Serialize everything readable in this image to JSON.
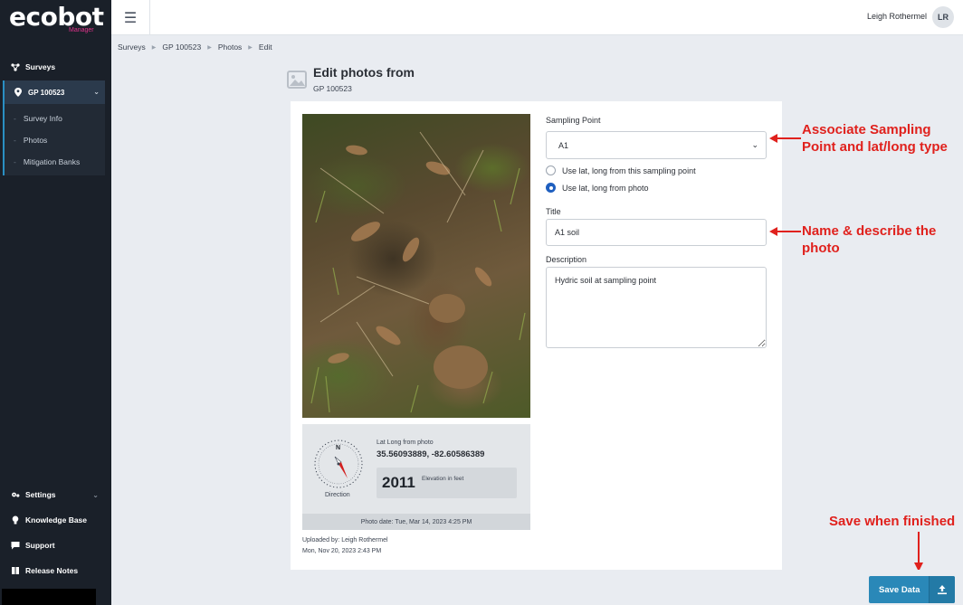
{
  "app": {
    "logo_text": "ecobot",
    "logo_sub": "Manager"
  },
  "sidebar": {
    "surveys_label": "Surveys",
    "survey_label": "GP 100523",
    "sub_items": [
      "Survey Info",
      "Photos",
      "Mitigation Banks"
    ],
    "settings_label": "Settings",
    "knowledge_label": "Knowledge Base",
    "support_label": "Support",
    "release_label": "Release Notes"
  },
  "topbar": {
    "user_name": "Leigh Rothermel",
    "avatar_initials": "LR"
  },
  "breadcrumb": [
    "Surveys",
    "GP 100523",
    "Photos",
    "Edit"
  ],
  "header": {
    "title": "Edit photos from",
    "subtitle": "GP 100523"
  },
  "photo": {
    "latlong_label": "Lat Long from photo",
    "latlong_value": "35.56093889, -82.60586389",
    "compass_letter": "N",
    "direction_label": "Direction",
    "elevation_value": "2011",
    "elevation_label": "Elevation in feet",
    "photo_date": "Photo date: Tue, Mar 14, 2023 4:25 PM",
    "uploaded_by": "Uploaded by: Leigh Rothermel",
    "uploaded_date": "Mon, Nov 20, 2023 2:43 PM"
  },
  "form": {
    "sampling_label": "Sampling Point",
    "sampling_value": "A1",
    "radio_option_1": "Use lat, long from this sampling point",
    "radio_option_2": "Use lat, long from photo",
    "selected_radio": 2,
    "title_label": "Title",
    "title_value": "A1 soil",
    "description_label": "Description",
    "description_value": "Hydric soil at sampling point"
  },
  "annotations": {
    "associate": "Associate Sampling Point and lat/long type",
    "name_describe": "Name & describe the photo",
    "save_finished": "Save when finished"
  },
  "actions": {
    "save_label": "Save Data"
  },
  "colors": {
    "sidebar_bg": "#1a2029",
    "accent": "#2a88b8",
    "annotation_red": "#e0211d",
    "radio_selected": "#1f5fbf"
  }
}
